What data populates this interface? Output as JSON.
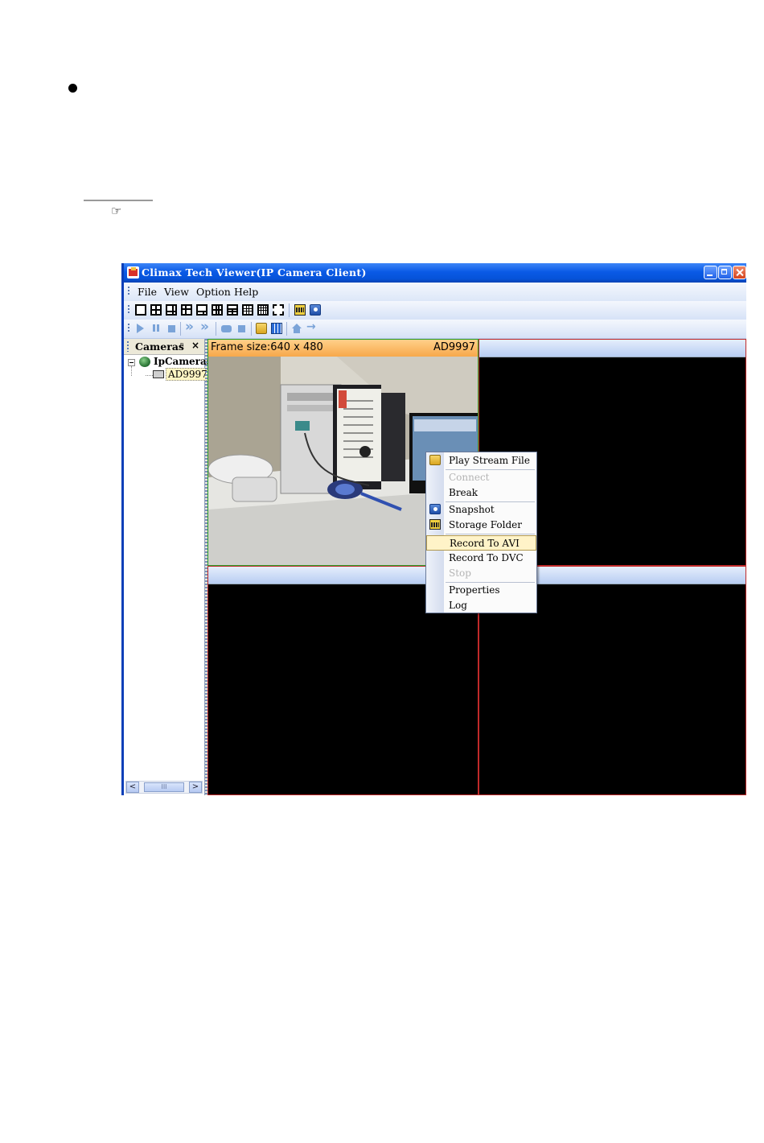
{
  "window": {
    "title": "Climax Tech Viewer(IP Camera Client)"
  },
  "menubar": {
    "items": [
      "File",
      "View",
      "Option",
      "Help"
    ]
  },
  "sidebar": {
    "title": "Cameras",
    "pin": "ꟷ",
    "close": "×",
    "root": "IpCameras",
    "child": "AD9997",
    "scroll_thumb": "III"
  },
  "pane1": {
    "frame_size": "Frame size:640 x 480",
    "camera_name": "AD9997"
  },
  "context_menu": {
    "items": [
      {
        "label": "Play Stream File",
        "icon": "open-folder-icon",
        "enabled": true
      },
      {
        "label": "Connect",
        "enabled": false
      },
      {
        "label": "Break",
        "enabled": true
      },
      {
        "label": "Snapshot",
        "icon": "snapshot-icon",
        "enabled": true
      },
      {
        "label": "Storage Folder",
        "icon": "storage-folder-icon",
        "enabled": true
      },
      {
        "label": "Record To AVI",
        "enabled": true,
        "highlighted": true
      },
      {
        "label": "Record To DVC",
        "enabled": true
      },
      {
        "label": "Stop",
        "enabled": false
      },
      {
        "label": "Properties",
        "enabled": true
      },
      {
        "label": "Log",
        "enabled": true
      }
    ]
  },
  "colors": {
    "titlebar": "#0a5ae6",
    "active_pane_header": "#f7a84a",
    "active_pane_border": "#2aa02a",
    "inactive_pane_border": "#c02a2a",
    "menu_highlight": "#fff3c8"
  }
}
